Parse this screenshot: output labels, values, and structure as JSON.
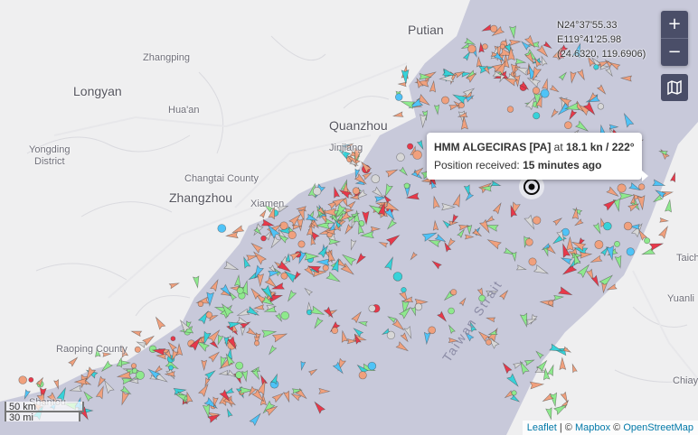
{
  "places": [
    {
      "label": "Putian",
      "type": "city"
    },
    {
      "label": "Zhangping",
      "type": "town"
    },
    {
      "label": "Longyan",
      "type": "city"
    },
    {
      "label": "Hua'an",
      "type": "town"
    },
    {
      "label": "Quanzhou",
      "type": "city"
    },
    {
      "label": "Jinjiang",
      "type": "town"
    },
    {
      "label": "Yongding",
      "type": "town"
    },
    {
      "label": "District",
      "type": "town"
    },
    {
      "label": "Changtai County",
      "type": "town"
    },
    {
      "label": "Zhangzhou",
      "type": "city"
    },
    {
      "label": "Xiamen",
      "type": "town"
    },
    {
      "label": "Raoping County",
      "type": "town"
    },
    {
      "label": "Shantou",
      "type": "town"
    },
    {
      "label": "Taichung",
      "type": "town"
    },
    {
      "label": "Yuanli",
      "type": "town"
    },
    {
      "label": "Chiayi",
      "type": "town"
    },
    {
      "label": "Taiwan Strait",
      "type": "sea"
    }
  ],
  "coordinates": {
    "lat": "N24°37'55.33",
    "lon": "E119°41'25.98",
    "decimal": "(24.6320, 119.6906)"
  },
  "controls": {
    "zoom_in": "+",
    "zoom_out": "−",
    "layers_icon": "map-layers-icon"
  },
  "tooltip": {
    "vessel_name": "HMM ALGECIRAS [PA]",
    "at": "at",
    "speed_course": "18.1 kn / 222°",
    "received_label": "Position received:",
    "received_value": "15 minutes ago"
  },
  "scale": {
    "metric": "50 km",
    "imperial": "30 mi"
  },
  "attribution": {
    "leaflet": "Leaflet",
    "sep1": "| ©",
    "mapbox": "Mapbox",
    "sep2": "©",
    "osm": "OpenStreetMap"
  },
  "colors": {
    "land": "#efeff0",
    "water": "#c8c9da",
    "cargo": "#f0a07d",
    "tanker": "#e8384a",
    "passenger": "#4fc3f7",
    "tug": "#36d2d9",
    "fishing": "#8ee98d",
    "pleasure": "#c89cf0",
    "unknown": "#d7d7d7",
    "highlight": "#0b0b0b"
  },
  "vessel_types_shown": [
    "cargo",
    "tanker",
    "passenger",
    "fishing",
    "tug",
    "unknown",
    "sar",
    "pleasure"
  ]
}
